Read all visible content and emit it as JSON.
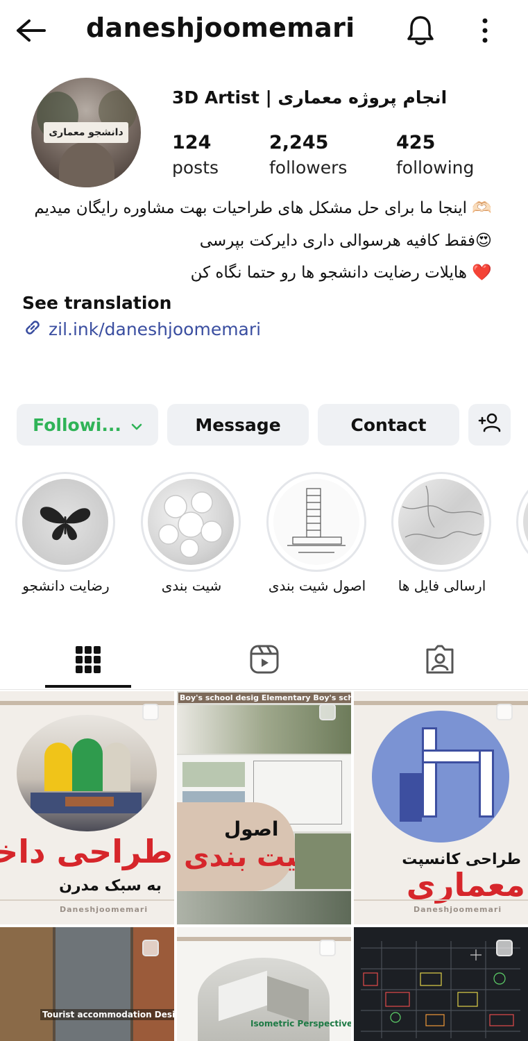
{
  "header": {
    "username": "daneshjoomemari",
    "back_icon": "back-arrow-icon",
    "bell_icon": "bell-icon",
    "more_icon": "more-vertical-icon"
  },
  "profile": {
    "avatar_text": "دانشجو معماری",
    "name": "3D Artist | انجام پروژه معماری",
    "stats": [
      {
        "value": "124",
        "label": "posts"
      },
      {
        "value": "2,245",
        "label": "followers"
      },
      {
        "value": "425",
        "label": "following"
      }
    ],
    "bio_lines": [
      "🫶🏻 اینجا ما برای حل مشکل های طراحیات بهت مشاوره رایگان میدیم",
      "😍فقط کافیه هرسوالی داری دایرکت بپرسی",
      "❤️ هایلات رضایت دانشجو ها رو حتما نگاه کن"
    ],
    "see_translation": "See translation",
    "link": "zil.ink/daneshjoomemari"
  },
  "actions": {
    "following": "Followi...",
    "message": "Message",
    "contact": "Contact"
  },
  "highlights": [
    {
      "label": "رضایت دانشجو"
    },
    {
      "label": "شیت بندی"
    },
    {
      "label": "اصول شیت بندی"
    },
    {
      "label": "ارسالی فایل ها"
    }
  ],
  "tabs": [
    "grid-icon",
    "reels-icon",
    "tagged-icon"
  ],
  "posts": [
    {
      "title": "طراحی داخلی",
      "subtitle": "به سبک مدرن",
      "footer": "Daneshjoomemari"
    },
    {
      "top_text": "Boy's school desig Elementary Boy's school desi",
      "title_top": "اصول",
      "title": "شیت بندی"
    },
    {
      "title_top": "طراحی کانسپت",
      "title": "معماری",
      "footer": "Daneshjoomemari"
    },
    {
      "caption": "Tourist accommodation Design"
    },
    {
      "caption": "Isometric Perspective"
    },
    {
      "caption": ""
    }
  ],
  "colors": {
    "following_green": "#2fb357",
    "link_blue": "#3a4ea0",
    "button_bg": "#eff1f4",
    "post_red": "#d6262b"
  }
}
